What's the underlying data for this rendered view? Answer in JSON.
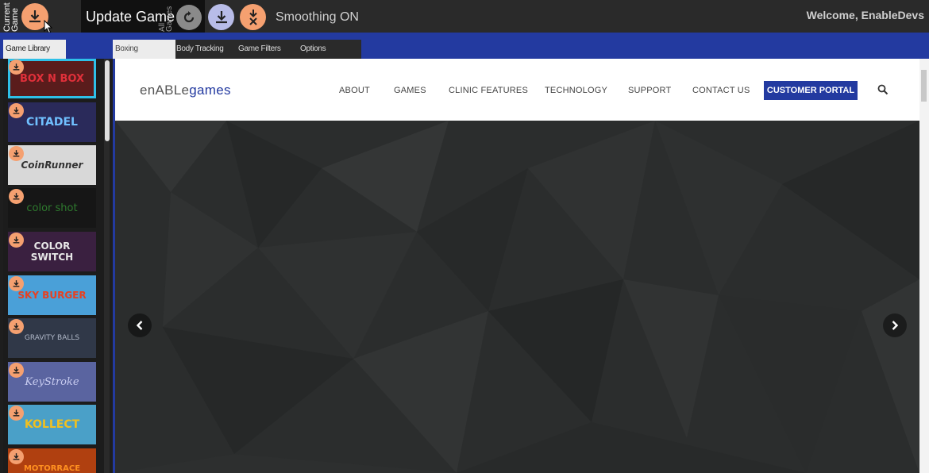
{
  "topbar": {
    "current_game_label": "Current Game",
    "update_label": "Update Game",
    "all_games_label": "All Games",
    "smoothing_label": "Smoothing ON",
    "welcome_text": "Welcome, EnableDevs"
  },
  "tabs": {
    "library_label": "Game Library",
    "items": [
      {
        "label": "Boxing"
      },
      {
        "label": "Body Tracking"
      },
      {
        "label": "Game Filters"
      },
      {
        "label": "Options"
      }
    ]
  },
  "library": {
    "games": [
      {
        "title": "BOX N BOX",
        "bg": "#5a1c1c",
        "color": "#e0303a"
      },
      {
        "title": "CITADEL",
        "bg": "#2a2a5a",
        "color": "#70c0ff"
      },
      {
        "title": "CoinRunner",
        "bg": "#d8d8d8",
        "color": "#333333"
      },
      {
        "title": "color shot",
        "bg": "#161616",
        "color": "#2e7a2e"
      },
      {
        "title": "COLOR SWITCH",
        "bg": "#3a2040",
        "color": "#e8e8e8"
      },
      {
        "title": "SKY BURGER",
        "bg": "#4aa0d8",
        "color": "#e84020"
      },
      {
        "title": "GRAVITY BALLS",
        "bg": "#303848",
        "color": "#b0b8c8"
      },
      {
        "title": "KeyStroke",
        "bg": "#5a64a0",
        "color": "#c8ccf0"
      },
      {
        "title": "KOLLECT",
        "bg": "#4aa0c8",
        "color": "#f0c020"
      },
      {
        "title": "MOTORRACE",
        "bg": "#b04010",
        "color": "#ff9020"
      }
    ]
  },
  "site": {
    "logo_prefix": "enABLe",
    "logo_suffix": "games",
    "nav": [
      "ABOUT",
      "GAMES",
      "CLINIC FEATURES",
      "TECHNOLOGY",
      "SUPPORT",
      "CONTACT US"
    ],
    "portal_label": "CUSTOMER PORTAL"
  },
  "colors": {
    "accent_blue": "#233aa0",
    "download_orange": "#f5a070",
    "selection_cyan": "#2ec0e8"
  },
  "icons": {
    "current_download": "download-icon",
    "reload": "reload-icon",
    "download_all": "download-all-icon",
    "delete_download": "delete-download-icon",
    "search": "search-icon",
    "prev": "chevron-left-icon",
    "next": "chevron-right-icon"
  }
}
